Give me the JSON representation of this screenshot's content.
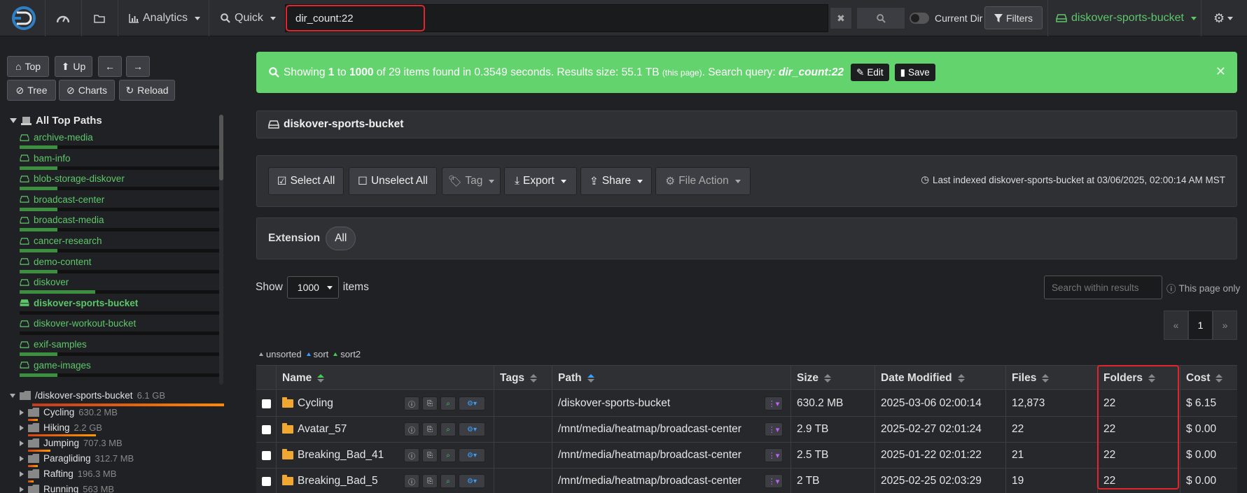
{
  "navbar": {
    "analytics_label": "Analytics",
    "quick_label": "Quick",
    "search_value": "dir_count:22",
    "current_dir_label": "Current Dir",
    "filters_label": "Filters",
    "index_name": "diskover-sports-bucket"
  },
  "sidebar": {
    "buttons": {
      "top": "Top",
      "up": "Up",
      "tree": "Tree",
      "charts": "Charts",
      "reload": "Reload"
    },
    "tree_title": "All Top Paths",
    "top_paths": [
      {
        "label": "archive-media",
        "fill": 0.19
      },
      {
        "label": "bam-info",
        "fill": 0.19
      },
      {
        "label": "blob-storage-diskover",
        "fill": 0.19
      },
      {
        "label": "broadcast-center",
        "fill": 0.19
      },
      {
        "label": "broadcast-media",
        "fill": 0.19
      },
      {
        "label": "cancer-research",
        "fill": 0.19
      },
      {
        "label": "demo-content",
        "fill": 0.19
      },
      {
        "label": "diskover",
        "fill": 0.38
      },
      {
        "label": "diskover-sports-bucket",
        "fill": 0.0
      },
      {
        "label": "diskover-workout-bucket",
        "fill": 0.0
      },
      {
        "label": "exif-samples",
        "fill": 0.19
      },
      {
        "label": "game-images",
        "fill": 0.19
      }
    ],
    "folder_root": {
      "label": "/diskover-sports-bucket",
      "size": "6.1 GB"
    },
    "sub_folders": [
      {
        "label": "Cycling",
        "size": "630.2 MB"
      },
      {
        "label": "Hiking",
        "size": "2.2 GB"
      },
      {
        "label": "Jumping",
        "size": "707.3 MB"
      },
      {
        "label": "Paragliding",
        "size": "312.7 MB"
      },
      {
        "label": "Rafting",
        "size": "196.3 MB"
      },
      {
        "label": "Running",
        "size": "563 MB"
      }
    ]
  },
  "alert": {
    "showing": "Showing",
    "from": "1",
    "to_word": "to",
    "to": "1000",
    "rest": "of 29 items found in 0.3549 seconds. Results size: 55.1 TB",
    "this_page": "(this page)",
    "query_prefix": ". Search query:",
    "query": "dir_count:22",
    "edit_label": "Edit",
    "save_label": "Save"
  },
  "panel_title": "diskover-sports-bucket",
  "toolbar": {
    "select_all": "Select All",
    "unselect_all": "Unselect All",
    "tag": "Tag",
    "export": "Export",
    "share": "Share",
    "file_action": "File Action",
    "last_indexed": "Last indexed diskover-sports-bucket at 03/06/2025, 02:00:14 AM MST"
  },
  "extension": {
    "label": "Extension",
    "pill": "All"
  },
  "show": {
    "prefix": "Show",
    "value": "1000",
    "suffix": "items"
  },
  "within": {
    "placeholder": "Search within results",
    "page_only": "This page only"
  },
  "pager": {
    "prev": "«",
    "current": "1",
    "next": "»"
  },
  "sort_legend": {
    "unsorted": "unsorted",
    "sort": "sort",
    "sort2": "sort2"
  },
  "table": {
    "headers": {
      "name": "Name",
      "tags": "Tags",
      "path": "Path",
      "size": "Size",
      "date_modified": "Date Modified",
      "files": "Files",
      "folders": "Folders",
      "cost": "Cost"
    },
    "rows": [
      {
        "name": "Cycling",
        "path": "/diskover-sports-bucket",
        "size": "630.2 MB",
        "date": "2025-03-06 02:00:14",
        "files": "12,873",
        "folders": "22",
        "cost": "$ 6.15"
      },
      {
        "name": "Avatar_57",
        "path": "/mnt/media/heatmap/broadcast-center",
        "size": "2.9 TB",
        "date": "2025-02-27 02:01:24",
        "files": "22",
        "folders": "22",
        "cost": "$ 0.00"
      },
      {
        "name": "Breaking_Bad_41",
        "path": "/mnt/media/heatmap/broadcast-center",
        "size": "2.5 TB",
        "date": "2025-01-22 02:01:22",
        "files": "21",
        "folders": "22",
        "cost": "$ 0.00"
      },
      {
        "name": "Breaking_Bad_5",
        "path": "/mnt/media/heatmap/broadcast-center",
        "size": "2 TB",
        "date": "2025-02-25 02:03:29",
        "files": "19",
        "folders": "22",
        "cost": "$ 0.00"
      }
    ]
  },
  "colors": {
    "accent_green": "#63d36e",
    "highlight_red": "#e0252d",
    "link_green": "#5ec76a"
  }
}
